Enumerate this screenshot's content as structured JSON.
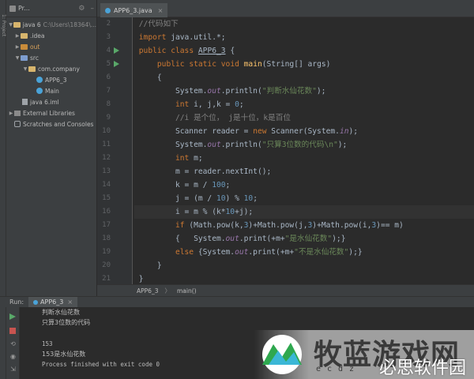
{
  "project_panel": {
    "title": "Pr...",
    "tree": [
      {
        "label": "java 6",
        "detail": "C:\\Users\\18364\\..."
      },
      {
        "label": ".idea"
      },
      {
        "label": "out"
      },
      {
        "label": "src"
      },
      {
        "label": "com.company"
      },
      {
        "label": "APP6_3"
      },
      {
        "label": "Main"
      },
      {
        "label": "java 6.iml"
      },
      {
        "label": "External Libraries"
      },
      {
        "label": "Scratches and Consoles"
      }
    ]
  },
  "editor": {
    "tab_label": "APP6_3.java",
    "line_numbers": [
      "2",
      "3",
      "4",
      "5",
      "6",
      "7",
      "8",
      "9",
      "10",
      "11",
      "12",
      "13",
      "14",
      "15",
      "16",
      "17",
      "18",
      "19",
      "20",
      "21"
    ],
    "lines": [
      "//代码如下",
      "import java.util.*;",
      "public class APP6_3 {",
      "    public static void main(String[] args)",
      "    {",
      "        System.out.println(\"判断水仙花数\");",
      "        int i, j,k = 0;",
      "        //i 是个位， j是十位，k是百位",
      "        Scanner reader = new Scanner(System.in);",
      "        System.out.println(\"只算3位数的代码\\n\");",
      "        int m;",
      "        m = reader.nextInt();",
      "        k = m / 100;",
      "        j = (m / 10) % 10;",
      "        i = m % (k*10+j);",
      "        if (Math.pow(k,3)+Math.pow(j,3)+Math.pow(i,3)== m)",
      "        {   System.out.print(+m+\"是水仙花数\");}",
      "        else {System.out.print(+m+\"不是水仙花数\");}",
      "    }",
      "}"
    ]
  },
  "breadcrumb": {
    "class_name": "APP6_3",
    "method_name": "main()"
  },
  "run_panel": {
    "label": "Run:",
    "tab_label": "APP6_3",
    "console": [
      "判断水仙花数",
      "只算3位数的代码",
      "",
      "153",
      "153是水仙花数",
      "Process finished with exit code 0"
    ]
  },
  "watermark": {
    "brand": "牧蓝游戏网",
    "site": "ecdz",
    "secondary": "必思软件园"
  },
  "colors": {
    "keyword": "#cc7832",
    "string": "#6a8759",
    "comment": "#808080",
    "number": "#6897bb",
    "method": "#ffc66d",
    "field": "#9876aa",
    "run_green": "#59a869"
  }
}
